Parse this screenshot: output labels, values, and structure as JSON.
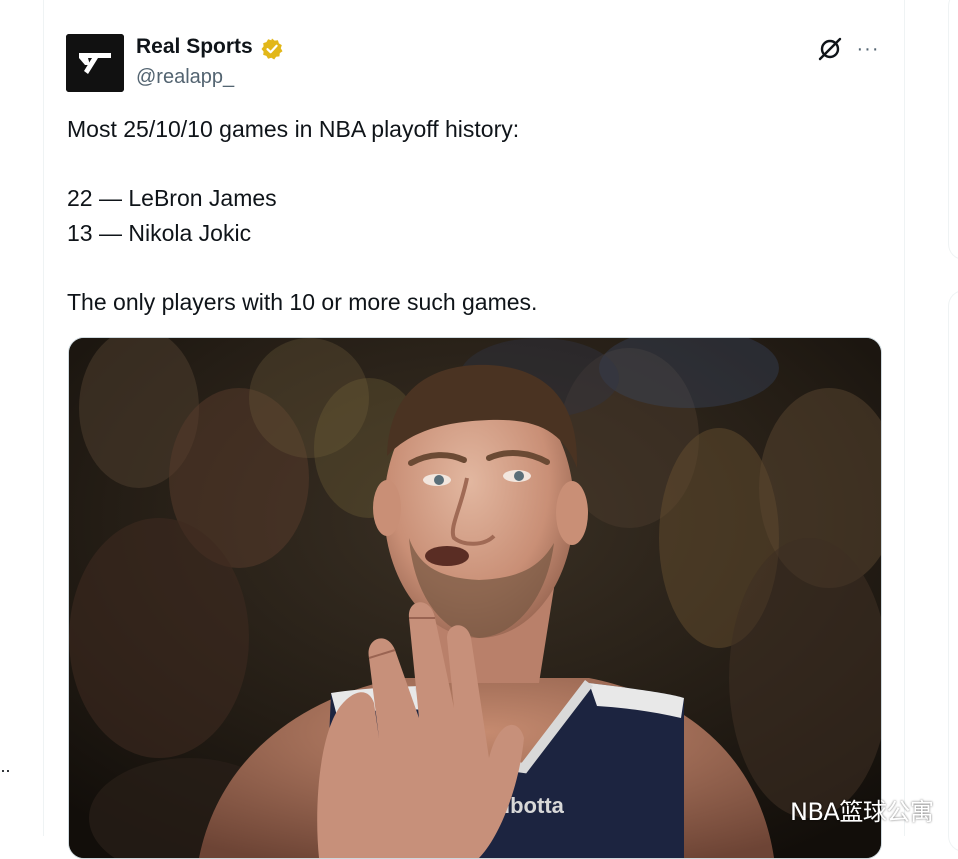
{
  "author": {
    "name": "Real Sports",
    "handle": "@realapp_",
    "verified": true,
    "verified_color": "#e2b719"
  },
  "header_actions": {
    "grok_icon": "grok-icon",
    "more_label": "···"
  },
  "tweet": {
    "line1": "Most 25/10/10 games in NBA playoff history:",
    "line2": "22 — LeBron James",
    "line3": "13 — Nikola Jokic",
    "line4": "The only players with 10 or more such games."
  },
  "media": {
    "jersey_text": "ibotta"
  },
  "left_rail": {
    "more_label": "··"
  },
  "watermark": "NBA篮球公寓"
}
